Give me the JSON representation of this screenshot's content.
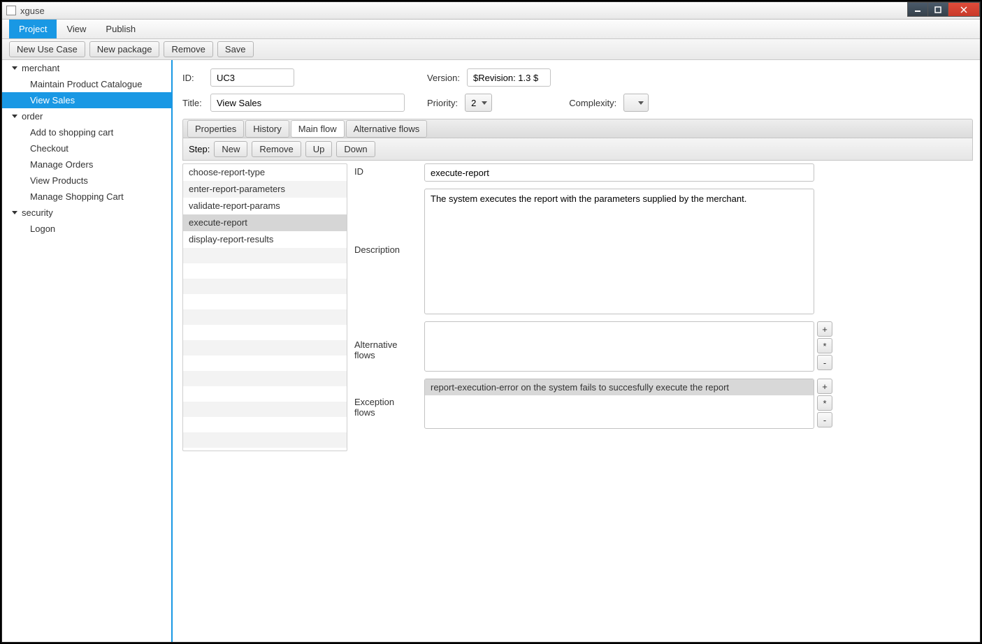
{
  "window": {
    "title": "xguse"
  },
  "menu": {
    "project": "Project",
    "view": "View",
    "publish": "Publish"
  },
  "toolbar": {
    "new_use_case": "New Use Case",
    "new_package": "New package",
    "remove": "Remove",
    "save": "Save"
  },
  "tree": {
    "groups": [
      {
        "name": "merchant",
        "items": [
          "Maintain Product Catalogue",
          "View Sales"
        ],
        "selectedIndex": 1
      },
      {
        "name": "order",
        "items": [
          "Add to shopping cart",
          "Checkout",
          "Manage Orders",
          "View Products",
          "Manage Shopping Cart"
        ]
      },
      {
        "name": "security",
        "items": [
          "Logon"
        ]
      }
    ]
  },
  "form": {
    "id_label": "ID:",
    "id_value": "UC3",
    "version_label": "Version:",
    "version_value": "$Revision: 1.3 $",
    "title_label": "Title:",
    "title_value": "View Sales",
    "priority_label": "Priority:",
    "priority_value": "2",
    "complexity_label": "Complexity:",
    "complexity_value": ""
  },
  "tabs": {
    "properties": "Properties",
    "history": "History",
    "main_flow": "Main flow",
    "alt_flows": "Alternative flows"
  },
  "steps_toolbar": {
    "label": "Step:",
    "new": "New",
    "remove": "Remove",
    "up": "Up",
    "down": "Down"
  },
  "steps": [
    "choose-report-type",
    "enter-report-parameters",
    "validate-report-params",
    "execute-report",
    "display-report-results"
  ],
  "steps_selected_index": 3,
  "detail": {
    "id_label": "ID",
    "id_value": "execute-report",
    "desc_label": "Description",
    "desc_value": "The system executes the report with the parameters supplied by the merchant.",
    "alt_label": "Alternative flows",
    "exc_label": "Exception flows",
    "exception_rows": [
      "report-execution-error on the system fails to succesfully execute the report"
    ]
  },
  "small_buttons": {
    "add": "+",
    "star": "*",
    "remove": "-"
  }
}
